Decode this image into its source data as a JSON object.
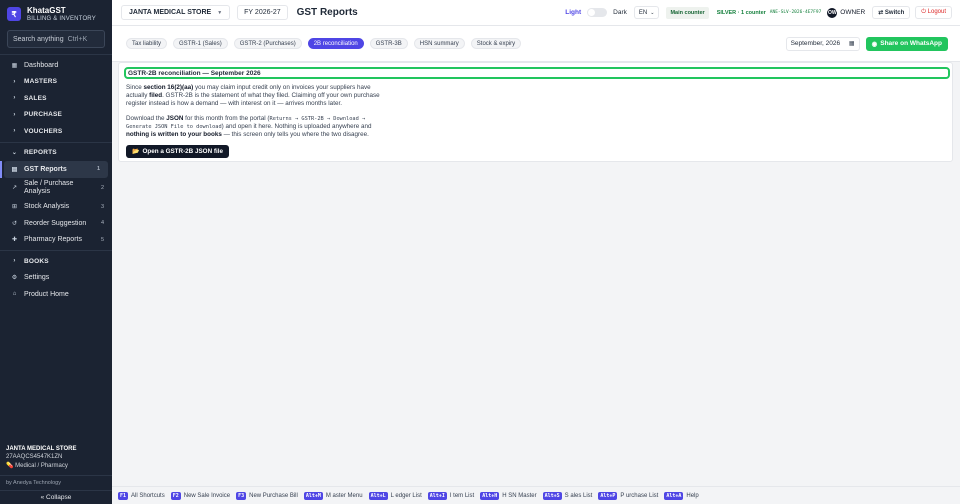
{
  "brand": {
    "logo": "₹",
    "name": "KhataGST",
    "subtitle": "BILLING & INVENTORY"
  },
  "search": {
    "placeholder": "Search anything",
    "shortcut": "Ctrl+K"
  },
  "sidebar": {
    "items": [
      {
        "label": "Dashboard",
        "icon": "▦"
      },
      {
        "label": "MASTERS",
        "icon": "›",
        "group": true
      },
      {
        "label": "SALES",
        "icon": "›",
        "group": true
      },
      {
        "label": "PURCHASE",
        "icon": "›",
        "group": true
      },
      {
        "label": "VOUCHERS",
        "icon": "›",
        "group": true
      },
      {
        "label": "REPORTS",
        "icon": "⌄",
        "group": true
      },
      {
        "label": "GST Reports",
        "icon": "▤",
        "badge": "1",
        "active": true
      },
      {
        "label": "Sale / Purchase Analysis",
        "icon": "↗",
        "badge": "2"
      },
      {
        "label": "Stock Analysis",
        "icon": "⊞",
        "badge": "3"
      },
      {
        "label": "Reorder Suggestion",
        "icon": "↺",
        "badge": "4"
      },
      {
        "label": "Pharmacy Reports",
        "icon": "✚",
        "badge": "5"
      },
      {
        "label": "BOOKS",
        "icon": "›",
        "group": true
      },
      {
        "label": "Settings",
        "icon": "⚙"
      },
      {
        "label": "Product Home",
        "icon": "⌂"
      }
    ]
  },
  "store_footer": {
    "name": "JANTA MEDICAL STORE",
    "gstin": "27AAQCS4547K1ZN",
    "type": "💊 Medical / Pharmacy",
    "by": "by Anedya Technology",
    "collapse": "« Collapse"
  },
  "topbar": {
    "store": "JANTA MEDICAL STORE",
    "fy": "FY 2026-27",
    "title": "GST Reports",
    "theme_light": "Light",
    "theme_dark": "Dark",
    "lang": "EN",
    "counter": "Main counter",
    "license": "SILVER · 1 counter",
    "license_code": "ANE-SLV-2026-4E7F97",
    "avatar": "OW",
    "role": "OWNER",
    "switch": "⇄ Switch",
    "logout": "⏻ Logout"
  },
  "tabs": [
    {
      "label": "Tax liability"
    },
    {
      "label": "GSTR-1 (Sales)"
    },
    {
      "label": "GSTR-2 (Purchases)"
    },
    {
      "label": "2B reconciliation",
      "active": true
    },
    {
      "label": "GSTR-3B"
    },
    {
      "label": "HSN summary"
    },
    {
      "label": "Stock & expiry"
    }
  ],
  "month": "September, 2026",
  "share_button": "Share on WhatsApp",
  "card": {
    "title": "GSTR-2B reconciliation — September 2026",
    "p1_a": "Since ",
    "p1_b": "section 16(2)(aa)",
    "p1_c": " you may claim input credit only on invoices your suppliers have actually ",
    "p1_d": "filed",
    "p1_e": ". GSTR-2B is the statement of what they filed. Claiming off your own purchase register instead is how a demand — with interest on it — arrives months later.",
    "p2_a": "Download the ",
    "p2_b": "JSON",
    "p2_c": " for this month from the portal (",
    "p2_code": "Returns → GSTR-2B → Download → Generate JSON File to download",
    "p2_d": ") and open it here. Nothing is uploaded anywhere and ",
    "p2_e": "nothing is written to your books",
    "p2_f": " — this screen only tells you where the two disagree.",
    "button": "Open a GSTR-2B JSON file"
  },
  "shortcuts": [
    {
      "key": "F1",
      "label": "All Shortcuts"
    },
    {
      "key": "F2",
      "label": "New Sale Invoice"
    },
    {
      "key": "F3",
      "label": "New Purchase Bill"
    },
    {
      "key": "Alt+M",
      "label": "M aster Menu"
    },
    {
      "key": "Alt+L",
      "label": "L edger List"
    },
    {
      "key": "Alt+I",
      "label": "I tem List"
    },
    {
      "key": "Alt+H",
      "label": "H SN Master"
    },
    {
      "key": "Alt+S",
      "label": "S ales List"
    },
    {
      "key": "Alt+P",
      "label": "P urchase List"
    },
    {
      "key": "Alt+A",
      "label": "Help"
    }
  ]
}
